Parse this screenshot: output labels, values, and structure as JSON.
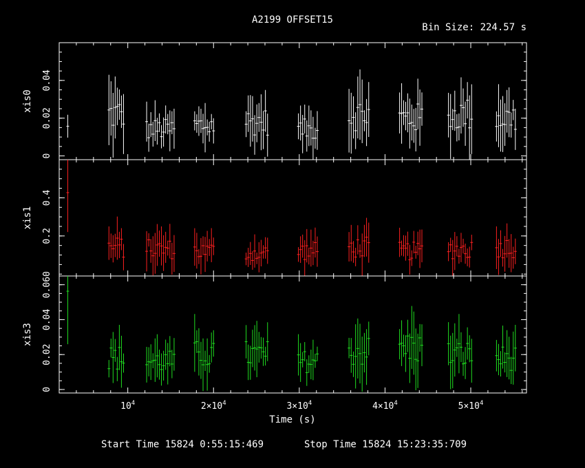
{
  "chart_data": {
    "type": "scatter",
    "title": "A2199 OFFSET15",
    "bin_size_label": "Bin Size: 224.57 s",
    "xlabel": "Time (s)",
    "x_ticks": [
      {
        "value": 10000,
        "label_main": "10",
        "label_exp": "4"
      },
      {
        "value": 20000,
        "label_main": "2×10",
        "label_exp": "4"
      },
      {
        "value": 30000,
        "label_main": "3×10",
        "label_exp": "4"
      },
      {
        "value": 40000,
        "label_main": "4×10",
        "label_exp": "4"
      },
      {
        "value": 50000,
        "label_main": "5×10",
        "label_exp": "4"
      }
    ],
    "xlim": [
      2000,
      56500
    ],
    "footer": {
      "start_label": "Start Time 15824  0:55:15:469",
      "stop_label": "Stop Time 15824 15:23:35:709"
    },
    "panels": [
      {
        "name": "xis0",
        "color": "#ffffff",
        "ylim": [
          -0.002,
          0.06
        ],
        "y_ticks": [
          {
            "value": 0,
            "label": "0"
          },
          {
            "value": 0.02,
            "label": "0.02"
          },
          {
            "value": 0.04,
            "label": "0.04"
          }
        ],
        "segments": [
          [
            3000,
            3000,
            0.014
          ],
          [
            7800,
            9500,
            0.022
          ],
          [
            12200,
            15400,
            0.014
          ],
          [
            17800,
            20000,
            0.016
          ],
          [
            23800,
            26300,
            0.018
          ],
          [
            29900,
            32100,
            0.014
          ],
          [
            35800,
            38100,
            0.022
          ],
          [
            41700,
            44300,
            0.02
          ],
          [
            47400,
            50100,
            0.022
          ],
          [
            53000,
            55200,
            0.02
          ]
        ]
      },
      {
        "name": "xis1",
        "color": "#ff2020",
        "ylim": [
          -0.01,
          0.6
        ],
        "y_ticks": [
          {
            "value": 0.2,
            "label": "0.2"
          },
          {
            "value": 0.4,
            "label": "0.4"
          }
        ],
        "segments": [
          [
            3000,
            3000,
            0.44
          ],
          [
            7800,
            9500,
            0.14
          ],
          [
            12200,
            15400,
            0.13
          ],
          [
            17800,
            20000,
            0.12
          ],
          [
            23800,
            26300,
            0.11
          ],
          [
            29900,
            32100,
            0.12
          ],
          [
            35800,
            38100,
            0.14
          ],
          [
            41700,
            44300,
            0.12
          ],
          [
            47400,
            50100,
            0.13
          ],
          [
            53000,
            55200,
            0.14
          ]
        ]
      },
      {
        "name": "xis3",
        "color": "#20e020",
        "ylim": [
          -0.002,
          0.065
        ],
        "y_ticks": [
          {
            "value": 0,
            "label": "0"
          },
          {
            "value": 0.02,
            "label": "0.02"
          },
          {
            "value": 0.04,
            "label": "0.04"
          },
          {
            "value": 0.06,
            "label": "0.060"
          }
        ],
        "segments": [
          [
            3000,
            3000,
            0.06
          ],
          [
            7800,
            9500,
            0.018
          ],
          [
            12200,
            15400,
            0.016
          ],
          [
            17800,
            20000,
            0.02
          ],
          [
            23800,
            26300,
            0.02
          ],
          [
            29900,
            32100,
            0.016
          ],
          [
            35800,
            38100,
            0.022
          ],
          [
            41700,
            44300,
            0.024
          ],
          [
            47400,
            50100,
            0.02
          ],
          [
            53000,
            55200,
            0.018
          ]
        ]
      }
    ]
  }
}
